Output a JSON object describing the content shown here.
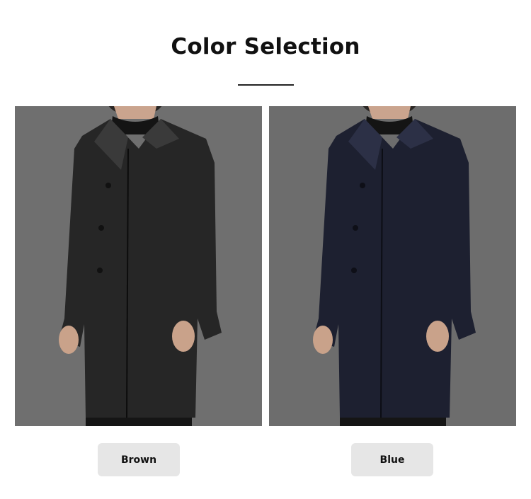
{
  "page": {
    "title": "Color Selection"
  },
  "options": [
    {
      "label": "Brown",
      "coat_color": "#262626",
      "coat_highlight": "#3a3a3a",
      "background": "#6f6f6f"
    },
    {
      "label": "Blue",
      "coat_color": "#1d2030",
      "coat_highlight": "#2c3046",
      "background": "#6d6d6d"
    }
  ],
  "button_style": {
    "background": "#e6e6e6"
  }
}
